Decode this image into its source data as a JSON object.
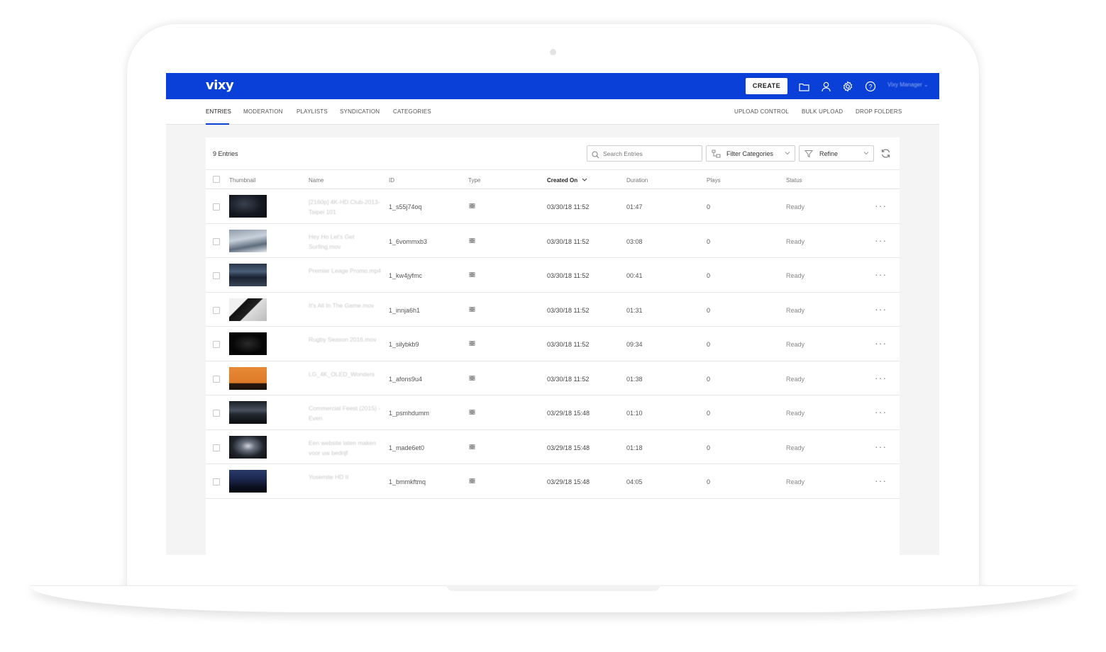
{
  "app": {
    "logo": "vixy",
    "create_label": "CREATE",
    "user_name": "Vixy Manager"
  },
  "nav": {
    "left_tabs": [
      "ENTRIES",
      "MODERATION",
      "PLAYLISTS",
      "SYNDICATION",
      "CATEGORIES"
    ],
    "right_tabs": [
      "UPLOAD CONTROL",
      "BULK UPLOAD",
      "DROP FOLDERS"
    ],
    "active_tab": "ENTRIES"
  },
  "toolbar": {
    "entries_count": "9 Entries",
    "search_placeholder": "Search Entries",
    "filter_label": "Filter Categories",
    "refine_label": "Refine"
  },
  "table": {
    "columns": [
      "Thumbnail",
      "Name",
      "ID",
      "Type",
      "Created On",
      "Duration",
      "Plays",
      "Status"
    ],
    "sorted_column": "Created On",
    "rows": [
      {
        "name": "[2160p] 4K-HD.Club-2013-Taipei 101",
        "id": "1_s55j74oq",
        "created": "03/30/18 11:52",
        "duration": "01:47",
        "plays": "0",
        "status": "Ready",
        "thumb": "dark-city"
      },
      {
        "name": "Hey Ho Let's Get Surfing.mov",
        "id": "1_6vommxb3",
        "created": "03/30/18 11:52",
        "duration": "03:08",
        "plays": "0",
        "status": "Ready",
        "thumb": "surf"
      },
      {
        "name": "Premier Leage Promo.mp4",
        "id": "1_kw4jyfmc",
        "created": "03/30/18 11:52",
        "duration": "00:41",
        "plays": "0",
        "status": "Ready",
        "thumb": "stadium"
      },
      {
        "name": "It's All In The Game.mov",
        "id": "1_innja6h1",
        "created": "03/30/18 11:52",
        "duration": "01:31",
        "plays": "0",
        "status": "Ready",
        "thumb": "bw"
      },
      {
        "name": "Rugby Season 2016.mov",
        "id": "1_silybkb9",
        "created": "03/30/18 11:52",
        "duration": "09:34",
        "plays": "0",
        "status": "Ready",
        "thumb": "black"
      },
      {
        "name": "LG_4K_OLED_Wonders",
        "id": "1_afons9u4",
        "created": "03/30/18 11:52",
        "duration": "01:38",
        "plays": "0",
        "status": "Ready",
        "thumb": "orange"
      },
      {
        "name": "Commercial Feest (2015) - Even",
        "id": "1_psmhdumm",
        "created": "03/29/18 15:48",
        "duration": "01:10",
        "plays": "0",
        "status": "Ready",
        "thumb": "dark-forest"
      },
      {
        "name": "Een website laten maken voor uw bedrijf",
        "id": "1_made6et0",
        "created": "03/29/18 15:48",
        "duration": "01:18",
        "plays": "0",
        "status": "Ready",
        "thumb": "figure"
      },
      {
        "name": "Yosemite HD II",
        "id": "1_bmmkftmq",
        "created": "03/29/18 15:48",
        "duration": "04:05",
        "plays": "0",
        "status": "Ready",
        "thumb": "night-sky"
      }
    ]
  },
  "colors": {
    "brand_blue": "#0a3fd8",
    "panel_bg": "#ffffff",
    "page_bg": "#f4f4f4"
  },
  "icons": [
    "folder-icon",
    "user-icon",
    "gear-icon",
    "help-icon",
    "search-icon",
    "filter-category-icon",
    "funnel-icon",
    "refresh-icon",
    "chevron-down-icon",
    "video-type-icon",
    "more-icon"
  ]
}
